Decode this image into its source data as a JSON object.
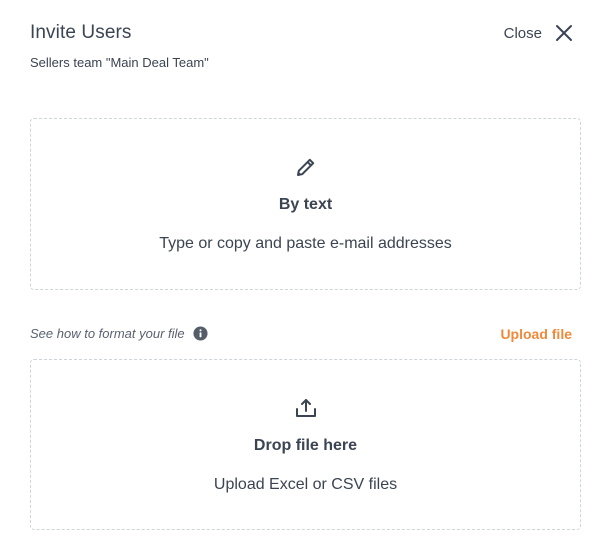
{
  "dialog": {
    "title": "Invite Users",
    "subtitle": "Sellers team \"Main Deal Team\"",
    "close_label": "Close"
  },
  "by_text": {
    "icon": "pencil-icon",
    "heading": "By text",
    "description": "Type or copy and paste e-mail addresses"
  },
  "file": {
    "format_hint": "See how to format your file",
    "info_icon": "info-icon",
    "upload_link": "Upload file",
    "icon": "upload-icon",
    "heading": "Drop file here",
    "description": "Upload Excel or CSV files"
  },
  "colors": {
    "text": "#3b4452",
    "accent": "#f0893a",
    "border": "#cfd4da"
  }
}
